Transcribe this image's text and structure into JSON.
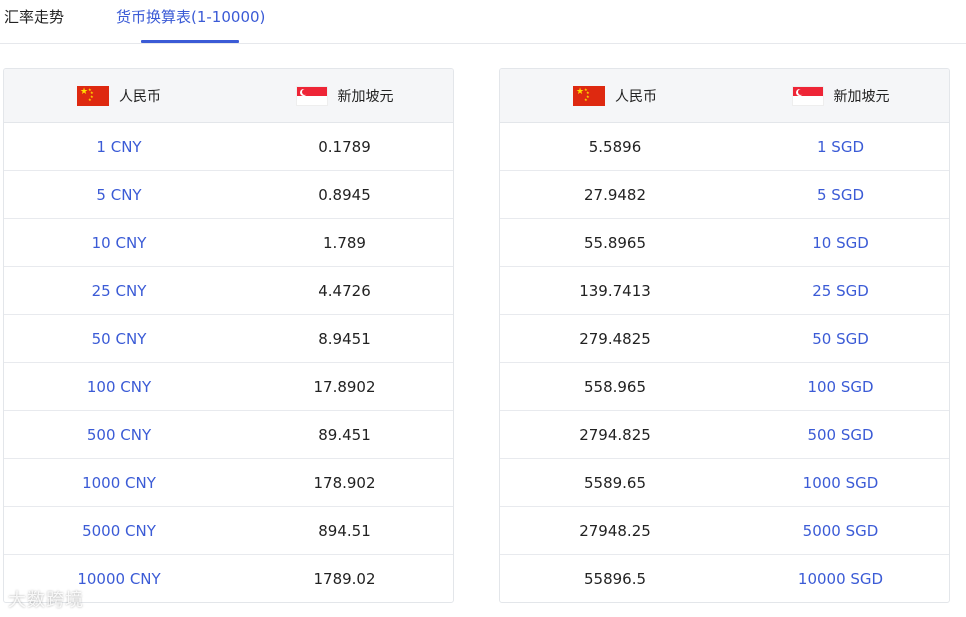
{
  "tabs": [
    {
      "label": "汇率走势"
    },
    {
      "label": "货币换算表(1-10000)"
    }
  ],
  "left_table": {
    "header_from": "人民币",
    "header_to": "新加坡元",
    "rows": [
      {
        "from": "1 CNY",
        "to": "0.1789"
      },
      {
        "from": "5 CNY",
        "to": "0.8945"
      },
      {
        "from": "10 CNY",
        "to": "1.789"
      },
      {
        "from": "25 CNY",
        "to": "4.4726"
      },
      {
        "from": "50 CNY",
        "to": "8.9451"
      },
      {
        "from": "100 CNY",
        "to": "17.8902"
      },
      {
        "from": "500 CNY",
        "to": "89.451"
      },
      {
        "from": "1000 CNY",
        "to": "178.902"
      },
      {
        "from": "5000 CNY",
        "to": "894.51"
      },
      {
        "from": "10000 CNY",
        "to": "1789.02"
      }
    ]
  },
  "right_table": {
    "header_from": "人民币",
    "header_to": "新加坡元",
    "rows": [
      {
        "from": "5.5896",
        "to": "1 SGD"
      },
      {
        "from": "27.9482",
        "to": "5 SGD"
      },
      {
        "from": "55.8965",
        "to": "10 SGD"
      },
      {
        "from": "139.7413",
        "to": "25 SGD"
      },
      {
        "from": "279.4825",
        "to": "50 SGD"
      },
      {
        "from": "558.965",
        "to": "100 SGD"
      },
      {
        "from": "2794.825",
        "to": "500 SGD"
      },
      {
        "from": "5589.65",
        "to": "1000 SGD"
      },
      {
        "from": "27948.25",
        "to": "5000 SGD"
      },
      {
        "from": "55896.5",
        "to": "10000 SGD"
      }
    ]
  },
  "watermark": "大数跨境",
  "colors": {
    "accent": "#3b5bd6",
    "header_bg": "#f5f6f8",
    "border": "#e3e6ea"
  },
  "icons": {
    "cn_flag": "china-flag-icon",
    "sg_flag": "singapore-flag-icon"
  }
}
